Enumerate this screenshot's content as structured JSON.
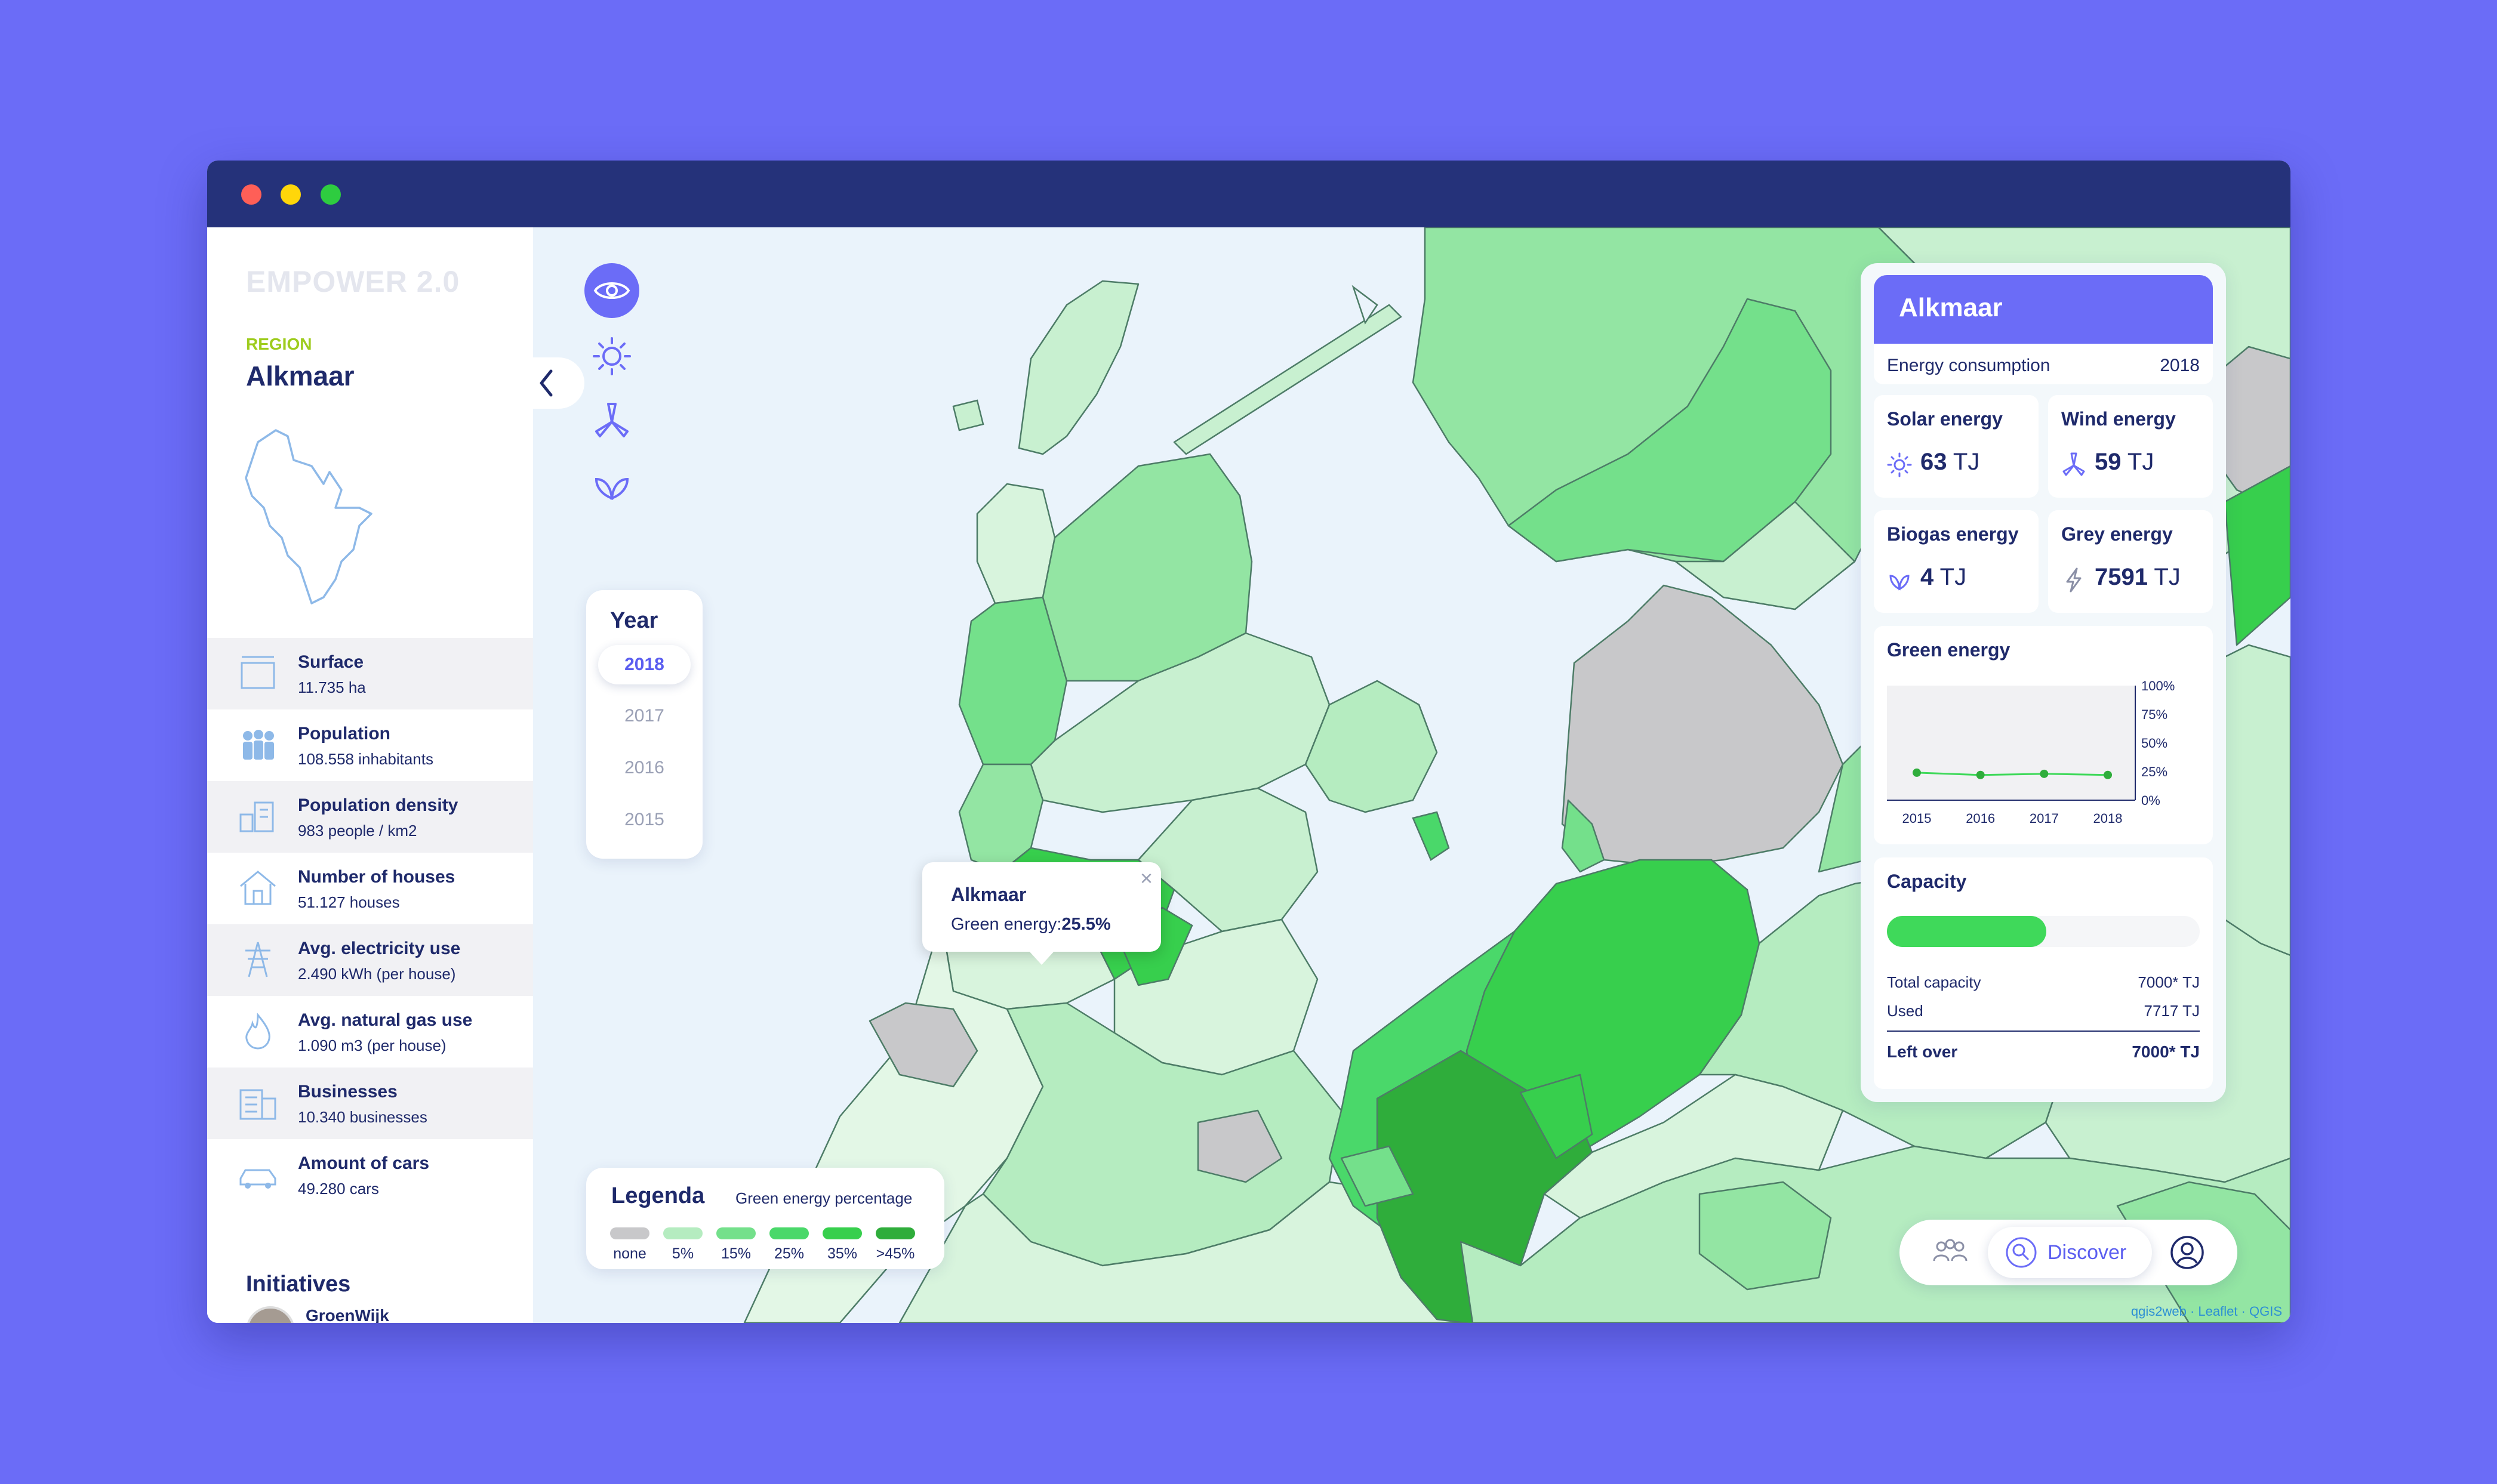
{
  "window": {
    "controls": {
      "close_color": "#ff5f57",
      "minimize_color": "#ffd60a",
      "maximize_color": "#2ecc40"
    }
  },
  "sidebar": {
    "brand": "EMPOWER 2.0",
    "region_label": "REGION",
    "region_name": "Alkmaar",
    "stats": [
      {
        "icon": "surface-icon",
        "title": "Surface",
        "value": "11.735 ha"
      },
      {
        "icon": "population-icon",
        "title": "Population",
        "value": "108.558 inhabitants"
      },
      {
        "icon": "population-density-icon",
        "title": "Population density",
        "value": "983 people / km2"
      },
      {
        "icon": "house-icon",
        "title": "Number of houses",
        "value": "51.127 houses"
      },
      {
        "icon": "electricity-pylon-icon",
        "title": "Avg. electricity use",
        "value": "2.490 kWh (per house)"
      },
      {
        "icon": "flame-icon",
        "title": "Avg. natural gas use",
        "value": "1.090 m3 (per house)"
      },
      {
        "icon": "building-icon",
        "title": "Businesses",
        "value": "10.340 businesses"
      },
      {
        "icon": "car-icon",
        "title": "Amount of cars",
        "value": "49.280 cars"
      }
    ],
    "initiatives_title": "Initiatives",
    "initiatives": [
      {
        "name": "GroenWijk"
      }
    ]
  },
  "map_controls": [
    {
      "icon": "eye-icon",
      "active": true
    },
    {
      "icon": "sun-icon",
      "active": false
    },
    {
      "icon": "wind-turbine-icon",
      "active": false
    },
    {
      "icon": "leaf-icon",
      "active": false
    }
  ],
  "year_selector": {
    "title": "Year",
    "years": [
      "2018",
      "2017",
      "2016",
      "2015"
    ],
    "selected": "2018"
  },
  "popup": {
    "name": "Alkmaar",
    "label": "Green energy:",
    "value": "25.5%",
    "close": "×"
  },
  "legend": {
    "title": "Legenda",
    "subtitle": "Green energy percentage",
    "items": [
      {
        "label": "none",
        "color": "#c8c8ca"
      },
      {
        "label": "5%",
        "color": "#b5ecc0"
      },
      {
        "label": "15%",
        "color": "#74e08b"
      },
      {
        "label": "25%",
        "color": "#4ad86a"
      },
      {
        "label": "35%",
        "color": "#37cf4d"
      },
      {
        "label": ">45%",
        "color": "#2fad3b"
      }
    ]
  },
  "panel": {
    "title": "Alkmaar",
    "consumption_label": "Energy consumption",
    "consumption_year": "2018",
    "energies": [
      {
        "icon": "sun-icon",
        "title": "Solar energy",
        "value": "63",
        "unit": "TJ"
      },
      {
        "icon": "wind-turbine-icon",
        "title": "Wind energy",
        "value": "59",
        "unit": "TJ"
      },
      {
        "icon": "leaf-icon",
        "title": "Biogas energy",
        "value": "4",
        "unit": "TJ"
      },
      {
        "icon": "lightning-icon",
        "title": "Grey energy",
        "value": "7591",
        "unit": "TJ"
      }
    ],
    "green_energy_title": "Green energy",
    "capacity": {
      "title": "Capacity",
      "fill_fraction": 0.51,
      "rows": [
        {
          "label": "Total capacity",
          "value": "7000* TJ"
        },
        {
          "label": "Used",
          "value": "7717 TJ"
        }
      ],
      "leftover_label": "Left over",
      "leftover_value": "7000* TJ"
    }
  },
  "chart_data": {
    "type": "line",
    "title": "Green energy",
    "categories": [
      "2015",
      "2016",
      "2017",
      "2018"
    ],
    "series": [
      {
        "values": [
          24,
          22,
          23,
          22
        ]
      }
    ],
    "y_ticks": [
      "100%",
      "75%",
      "50%",
      "25%",
      "0%"
    ],
    "ylim": [
      0,
      100
    ],
    "grid": false
  },
  "bottom_nav": {
    "items": [
      {
        "icon": "community-icon",
        "label": ""
      },
      {
        "icon": "discover-icon",
        "label": "Discover"
      },
      {
        "icon": "profile-icon",
        "label": ""
      }
    ]
  },
  "attribution": "qgis2web · Leaflet · QGIS",
  "colors": {
    "accent": "#6b6cf7",
    "navy": "#1f2a6b",
    "region_label": "#9ecc1e"
  }
}
